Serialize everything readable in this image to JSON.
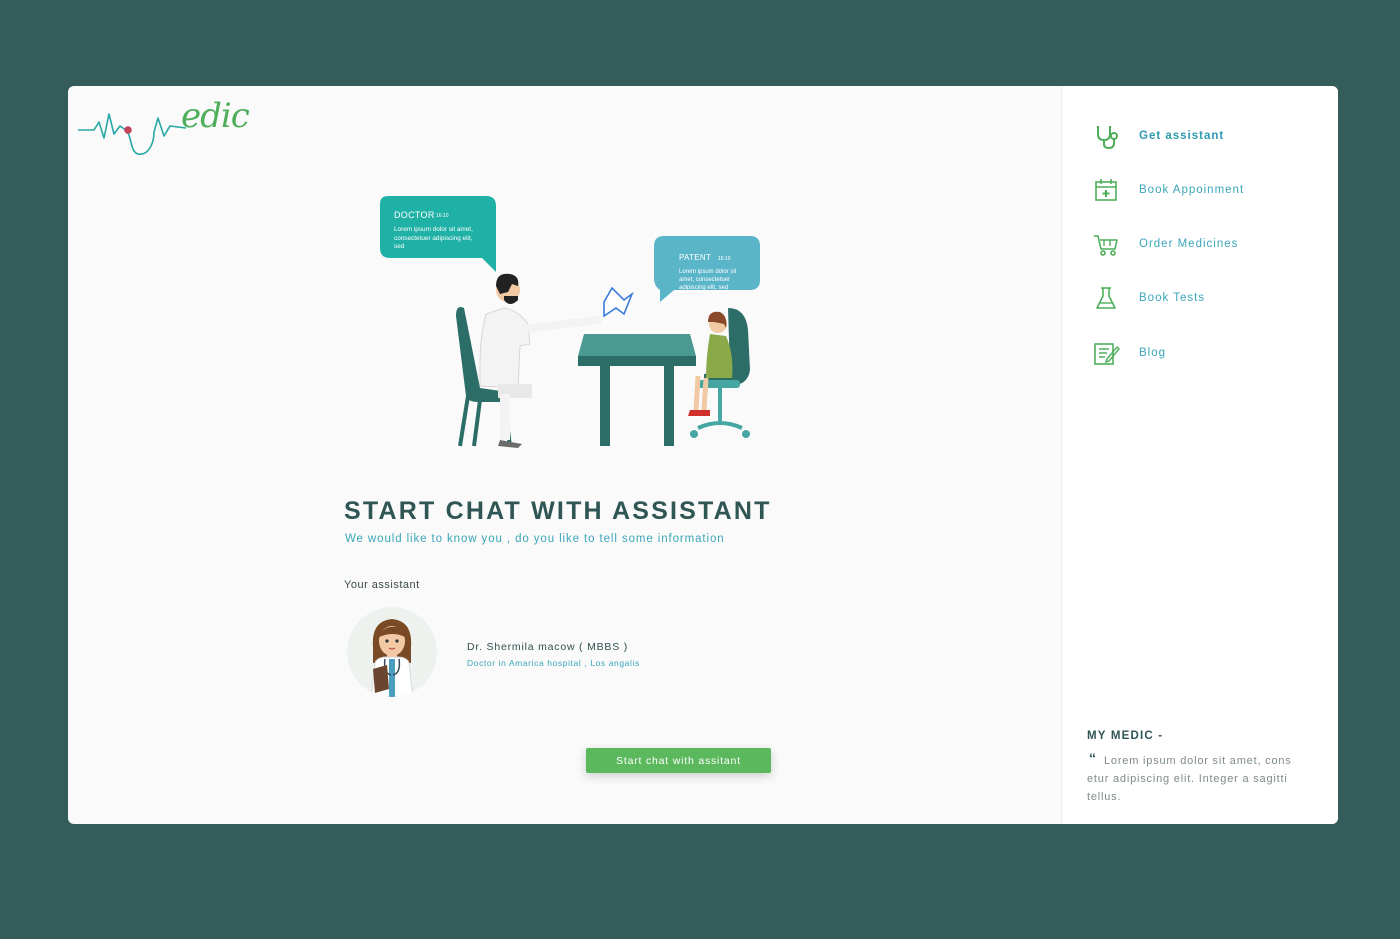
{
  "logo": {
    "text": "edic"
  },
  "illustration": {
    "doctor_bubble": {
      "title": "DOCTOR",
      "time": "16:10",
      "message": "Lorem ipsum dolor sit amet, consectetuer adipiscing elit, sed"
    },
    "patient_bubble": {
      "title": "PATENT",
      "time": "16:10",
      "message": "Lorem ipsum dolor sit amet, consectetuer adipiscing elit, sed"
    }
  },
  "main": {
    "title": "START CHAT WITH ASSISTANT",
    "subtitle": "We would like to know you , do you like to tell some information",
    "assistant_label": "Your assistant",
    "doctor_name": "Dr. Shermila macow ( MBBS )",
    "doctor_desc": "Doctor in Amarica hospital , Los angalis",
    "start_button": "Start chat with assitant"
  },
  "sidebar": {
    "items": [
      {
        "label": "Get assistant",
        "icon": "stethoscope-icon",
        "active": true
      },
      {
        "label": "Book Appoinment",
        "icon": "calendar-icon"
      },
      {
        "label": "Order Medicines",
        "icon": "cart-icon"
      },
      {
        "label": "Book Tests",
        "icon": "flask-icon"
      },
      {
        "label": "Blog",
        "icon": "blog-icon"
      }
    ],
    "brand_title": "MY MEDIC -",
    "quote_mark": "“",
    "brand_quote": "Lorem ipsum dolor sit amet, cons etur adipiscing elit. Integer a sagitti tellus."
  },
  "colors": {
    "background": "#335c5a",
    "accent_teal": "#3aa6b9",
    "title_dark": "#2f5555",
    "button_green": "#5cb85c",
    "logo_green": "#4fae5a",
    "bubble_doctor": "#1fb0a6",
    "bubble_patient": "#5bb5c9"
  }
}
